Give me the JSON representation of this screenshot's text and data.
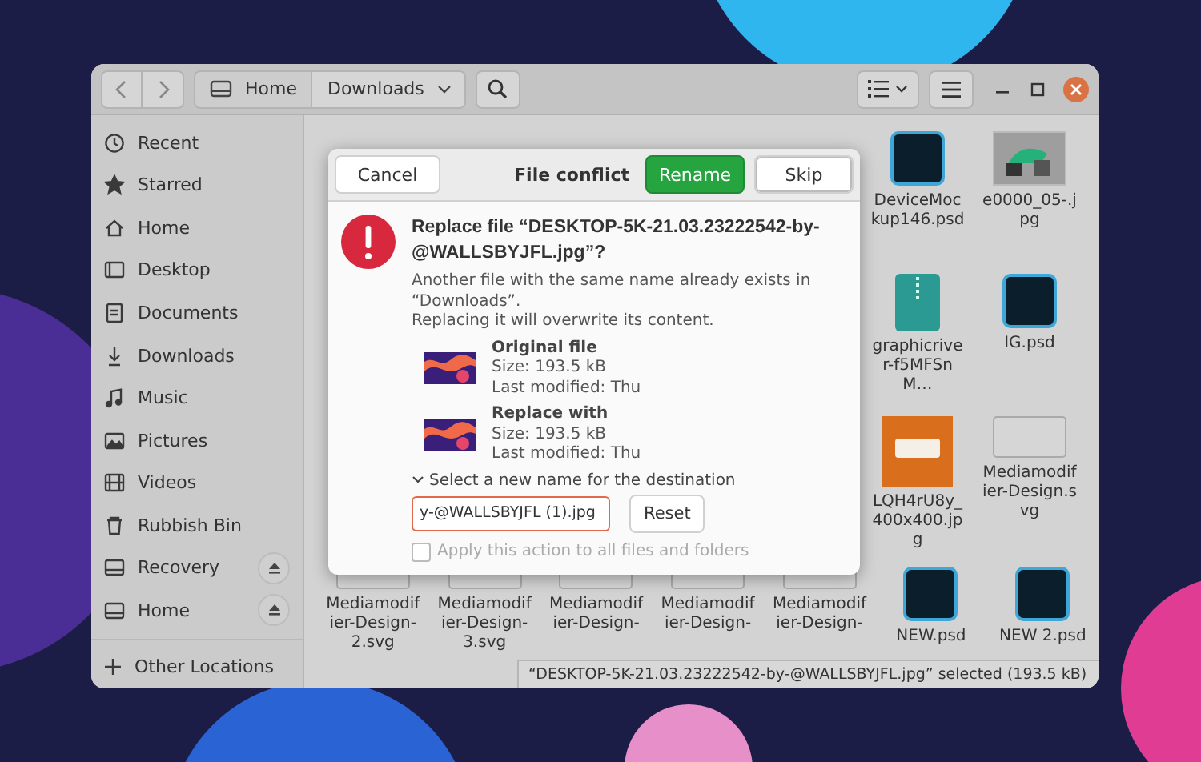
{
  "header": {
    "back": {
      "disabled": true
    },
    "forward": {
      "disabled": true
    },
    "path": [
      {
        "label": "Home",
        "selected": false
      },
      {
        "label": "Downloads",
        "selected": true
      }
    ]
  },
  "sidebar": {
    "items": [
      {
        "label": "Recent",
        "ejectable": false
      },
      {
        "label": "Starred",
        "ejectable": false
      },
      {
        "label": "Home",
        "ejectable": false
      },
      {
        "label": "Desktop",
        "ejectable": false
      },
      {
        "label": "Documents",
        "ejectable": false
      },
      {
        "label": "Downloads",
        "ejectable": false
      },
      {
        "label": "Music",
        "ejectable": false
      },
      {
        "label": "Pictures",
        "ejectable": false
      },
      {
        "label": "Videos",
        "ejectable": false
      },
      {
        "label": "Rubbish Bin",
        "ejectable": false
      },
      {
        "label": "Recovery",
        "ejectable": true
      },
      {
        "label": "Home",
        "ejectable": true
      }
    ],
    "other_locations": "Other Locations"
  },
  "files": [
    {
      "name": "DeviceMockup146.psd",
      "kind": "psd"
    },
    {
      "name": "e0000_05-.jpg",
      "kind": "photo"
    },
    {
      "name": "graphicriver-f5MFSnM…",
      "kind": "zip"
    },
    {
      "name": "IG.psd",
      "kind": "psd"
    },
    {
      "name": "LQH4rU8y_400x400.jpg",
      "kind": "orange"
    },
    {
      "name": "Mediamodifier-Design.svg",
      "kind": "svg"
    },
    {
      "name": "Mediamodifier-Design-2.svg",
      "kind": "svg"
    },
    {
      "name": "Mediamodifier-Design-3.svg",
      "kind": "svg"
    },
    {
      "name": "Mediamodifier-Design-",
      "kind": "svg"
    },
    {
      "name": "Mediamodifier-Design-",
      "kind": "svg"
    },
    {
      "name": "Mediamodifier-Design-",
      "kind": "svg"
    },
    {
      "name": "NEW.psd",
      "kind": "psd"
    },
    {
      "name": "NEW 2.psd",
      "kind": "psd"
    }
  ],
  "status_bar": "“DESKTOP-5K-21.03.23222542-by-@WALLSBYJFL.jpg” selected  (193.5 kB)",
  "dialog": {
    "buttons": [
      {
        "label": "Cancel",
        "kind": "plain",
        "selected": false
      },
      {
        "label": "Rename",
        "kind": "suggested",
        "selected": false
      },
      {
        "label": "Skip",
        "kind": "plain",
        "selected": true
      }
    ],
    "title": "File conflict",
    "heading": "Replace file “DESKTOP-5K-21.03.23222542-by-@WALLSBYJFL.jpg”?",
    "message": [
      "Another file with the same name already exists in “Downloads”.",
      "Replacing it will overwrite its content."
    ],
    "files": [
      {
        "label": "Original file",
        "size": "Size: 193.5 kB",
        "modified": "Last modified: Thu"
      },
      {
        "label": "Replace with",
        "size": "Size: 193.5 kB",
        "modified": "Last modified: Thu"
      }
    ],
    "expander": {
      "label": "Select a new name for the destination",
      "expanded": true
    },
    "new_name": "y-@WALLSBYJFL (1).jpg",
    "reset": "Reset",
    "apply_all": {
      "label": "Apply this action to all files and folders",
      "checked": false,
      "disabled": true
    }
  }
}
